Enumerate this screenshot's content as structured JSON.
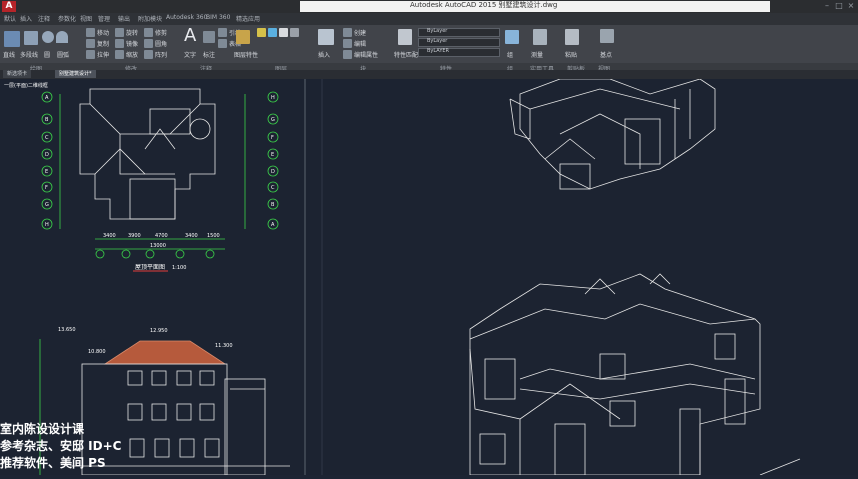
{
  "app": {
    "logo": "A",
    "title": "Autodesk AutoCAD 2015   别墅建筑设计.dwg"
  },
  "menu": {
    "items": [
      "默认",
      "插入",
      "注释",
      "参数化",
      "视图",
      "管理",
      "输出",
      "附加模块",
      "Autodesk 360",
      "BIM 360",
      "精选应用"
    ]
  },
  "ribbon": {
    "panels": [
      "绘图",
      "修改",
      "注释",
      "图层",
      "块",
      "特性",
      "组",
      "实用工具",
      "剪贴板",
      "视图"
    ],
    "items": {
      "move": "移动",
      "rotate": "旋转",
      "trim": "修剪",
      "copy": "复制",
      "mirror": "镜像",
      "fillet": "圆角",
      "stretch": "拉伸",
      "scale": "缩放",
      "array": "阵列",
      "text": "文字",
      "dimension": "标注",
      "table": "表格",
      "leader": "引线",
      "layer_props": "图层特性",
      "insert": "插入",
      "create": "创建",
      "edit": "编辑",
      "edit_attr": "编辑属性",
      "match": "特性匹配",
      "group": "组",
      "measure": "测量",
      "paste": "粘贴",
      "base": "基点",
      "line": "直线",
      "polyline": "多段线",
      "circle": "圆",
      "arc": "圆弧"
    },
    "dropdowns": [
      "ByLayer",
      "ByLayer",
      "ByLAYER"
    ]
  },
  "tabs": [
    {
      "label": "新选项卡",
      "active": false
    },
    {
      "label": "别墅建筑设计*",
      "active": true
    }
  ],
  "canvas": {
    "floor_plan_title": "屋顶平面图",
    "plan_scale": "1:100",
    "view_label": "一层(平面)二维线框",
    "dimensions_bottom": [
      "3400",
      "3900",
      "4700",
      "3400",
      "1500"
    ],
    "dim_total": "13000",
    "grid_left": [
      "A",
      "B",
      "C",
      "D",
      "E",
      "F",
      "G",
      "H"
    ],
    "grid_right": [
      "H",
      "G",
      "F",
      "E",
      "D",
      "C",
      "B",
      "A"
    ],
    "elevation_levels": [
      "13.650",
      "12.950",
      "11.300",
      "10.800"
    ]
  },
  "overlay": {
    "line1": "室内陈设设计课",
    "line2": "参考杂志、安邸  ID+C",
    "line3": "推荐软件、美间  PS"
  }
}
